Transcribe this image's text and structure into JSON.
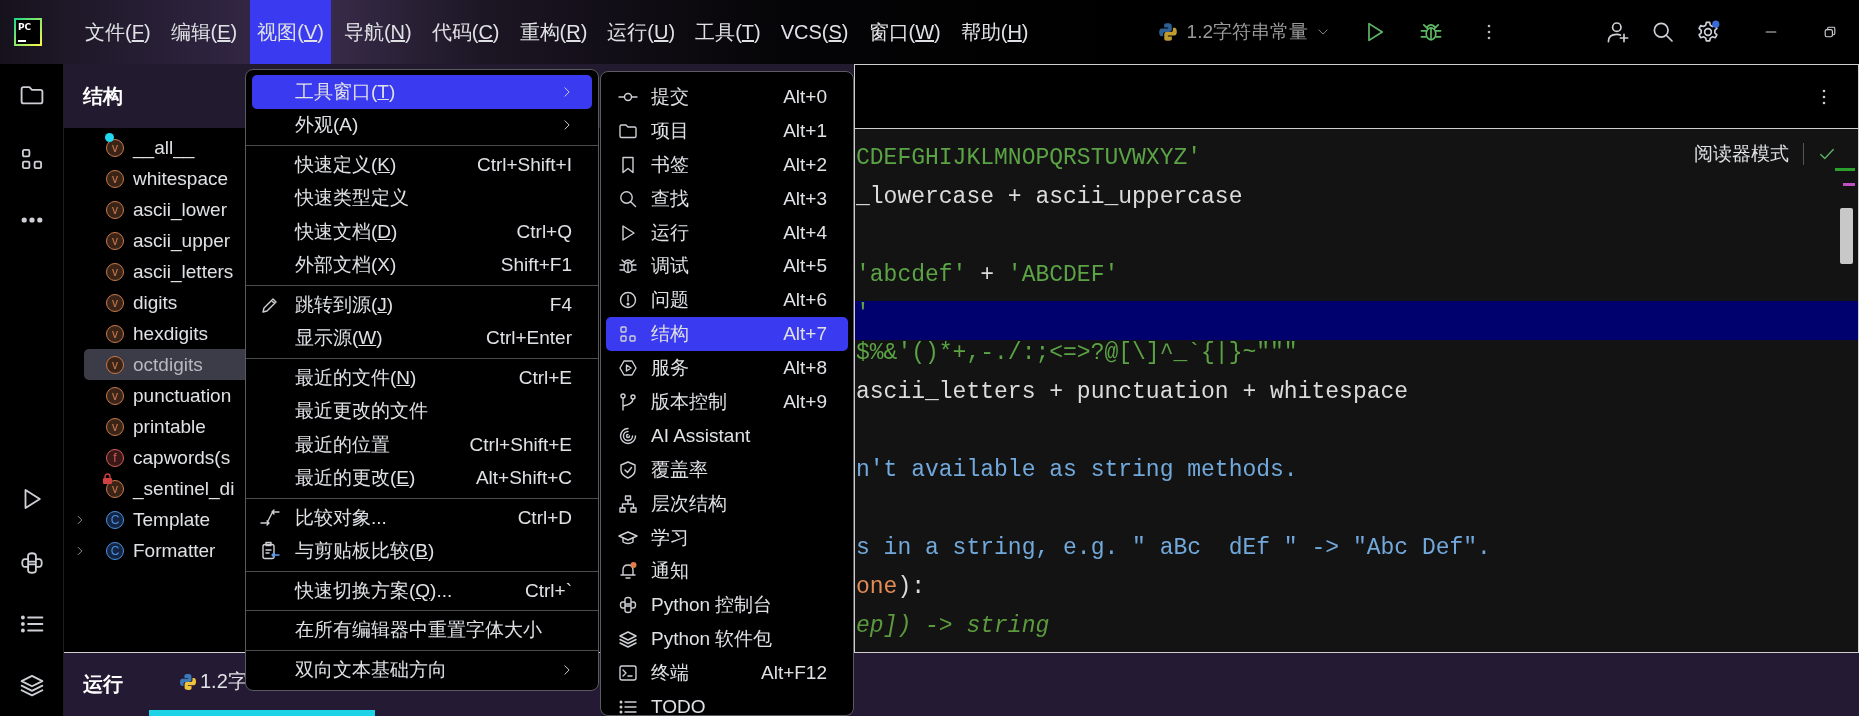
{
  "app_logo": "PC",
  "menubar": {
    "items": [
      {
        "text": [
          "文件(",
          "F",
          ")"
        ],
        "selected": false
      },
      {
        "text": [
          "编辑(",
          "E",
          ")"
        ],
        "selected": false
      },
      {
        "text": [
          "视图(",
          "V",
          ")"
        ],
        "selected": true
      },
      {
        "text": [
          "导航(",
          "N",
          ")"
        ],
        "selected": false
      },
      {
        "text": [
          "代码(",
          "C",
          ")"
        ],
        "selected": false
      },
      {
        "text": [
          "重构(",
          "R",
          ")"
        ],
        "selected": false
      },
      {
        "text": [
          "运行(",
          "U",
          ")"
        ],
        "selected": false
      },
      {
        "text": [
          "工具(",
          "T",
          ")"
        ],
        "selected": false
      },
      {
        "text": [
          "VCS(",
          "S",
          ")"
        ],
        "selected": false
      },
      {
        "text": [
          "窗口(",
          "W",
          ")"
        ],
        "selected": false
      },
      {
        "text": [
          "帮助(",
          "H",
          ")"
        ],
        "selected": false
      }
    ]
  },
  "run_config": {
    "label": "1.2字符串常量"
  },
  "structure_panel": {
    "title": "结构",
    "items": [
      {
        "kind": "variable",
        "icon_letter": "v",
        "label": "__all__",
        "selected": false,
        "flagged": true,
        "locked": false
      },
      {
        "kind": "variable",
        "icon_letter": "v",
        "label": "whitespace",
        "selected": false
      },
      {
        "kind": "variable",
        "icon_letter": "v",
        "label": "ascii_lower",
        "selected": false
      },
      {
        "kind": "variable",
        "icon_letter": "v",
        "label": "ascii_upper",
        "selected": false
      },
      {
        "kind": "variable",
        "icon_letter": "v",
        "label": "ascii_letters",
        "selected": false
      },
      {
        "kind": "variable",
        "icon_letter": "v",
        "label": "digits",
        "selected": false
      },
      {
        "kind": "variable",
        "icon_letter": "v",
        "label": "hexdigits",
        "selected": false
      },
      {
        "kind": "variable",
        "icon_letter": "v",
        "label": "octdigits",
        "selected": true
      },
      {
        "kind": "variable",
        "icon_letter": "v",
        "label": "punctuation",
        "selected": false
      },
      {
        "kind": "variable",
        "icon_letter": "v",
        "label": "printable",
        "selected": false
      },
      {
        "kind": "function",
        "icon_letter": "f",
        "label": "capwords(s",
        "selected": false
      },
      {
        "kind": "variable",
        "icon_letter": "v",
        "label": "_sentinel_di",
        "selected": false,
        "flagged": false,
        "locked": true
      },
      {
        "kind": "class",
        "icon_letter": "C",
        "label": "Template",
        "selected": false,
        "expanded": false
      },
      {
        "kind": "class",
        "icon_letter": "C",
        "label": "Formatter",
        "selected": false,
        "expanded": false
      }
    ]
  },
  "editor": {
    "reader_mode": "阅读器模式",
    "lines": [
      {
        "highlighted": false,
        "tokens": [
          {
            "kind": "string",
            "text": "CDEFGHIJKLMNOPQRSTUVWXYZ'"
          }
        ]
      },
      {
        "highlighted": false,
        "tokens": [
          {
            "kind": "plain",
            "text": "_lowercase + ascii_uppercase"
          }
        ]
      },
      {
        "highlighted": false
      },
      {
        "highlighted": false,
        "tokens": [
          {
            "kind": "string",
            "text": "'abcdef'"
          },
          {
            "kind": "plain",
            "text": " + "
          },
          {
            "kind": "string",
            "text": "'ABCDEF'"
          }
        ]
      },
      {
        "highlighted": true,
        "tokens": [
          {
            "kind": "string",
            "text": "'"
          }
        ]
      },
      {
        "highlighted": false,
        "tokens": [
          {
            "kind": "string",
            "text": "$%&'()*+,-./:;<=>?@[\\]^_`{|}~\"\"\""
          }
        ]
      },
      {
        "highlighted": false,
        "tokens": [
          {
            "kind": "plain",
            "text": "ascii_letters + punctuation + whitespace"
          }
        ]
      },
      {
        "highlighted": false
      },
      {
        "highlighted": false,
        "tokens": [
          {
            "kind": "doc",
            "text": "n't available as string methods."
          }
        ]
      },
      {
        "highlighted": false
      },
      {
        "highlighted": false,
        "tokens": [
          {
            "kind": "doc",
            "text": "s in a string, e.g. \" aBc  dEf \" -> \"Abc Def\"."
          }
        ]
      },
      {
        "highlighted": false,
        "tokens": [
          {
            "kind": "param",
            "text": "one"
          },
          {
            "kind": "plain",
            "text": "):"
          }
        ]
      },
      {
        "highlighted": false,
        "tokens": [
          {
            "kind": "comment",
            "text": "ep]) -> string"
          }
        ]
      }
    ]
  },
  "run_panel": {
    "title": "运行",
    "tab": {
      "label": "1.2字",
      "selected": true
    }
  },
  "view_menu": {
    "items": [
      {
        "kind": "item",
        "text": [
          "工具窗口(",
          "T",
          ")"
        ],
        "submenu": true,
        "selected": true
      },
      {
        "kind": "item",
        "text": [
          "外观(A)"
        ],
        "submenu": true,
        "selected": false
      },
      {
        "kind": "separator"
      },
      {
        "kind": "item",
        "text": [
          "快速定义(",
          "K",
          ")"
        ],
        "shortcut": "Ctrl+Shift+I",
        "submenu": false,
        "selected": false
      },
      {
        "kind": "item",
        "text": [
          "快速类型定义"
        ],
        "submenu": false,
        "selected": false
      },
      {
        "kind": "item",
        "text": [
          "快速文档(",
          "D",
          ")"
        ],
        "shortcut": "Ctrl+Q",
        "submenu": false,
        "selected": false
      },
      {
        "kind": "item",
        "text": [
          "外部文档(X)"
        ],
        "shortcut": "Shift+F1",
        "submenu": false,
        "selected": false
      },
      {
        "kind": "separator"
      },
      {
        "kind": "item",
        "text": [
          "跳转到源(",
          "J",
          ")"
        ],
        "shortcut": "F4",
        "submenu": false,
        "selected": false
      },
      {
        "kind": "item",
        "text": [
          "显示源(",
          "W",
          ")"
        ],
        "shortcut": "Ctrl+Enter",
        "submenu": false,
        "selected": false
      },
      {
        "kind": "separator"
      },
      {
        "kind": "item",
        "text": [
          "最近的文件(",
          "N",
          ")"
        ],
        "shortcut": "Ctrl+E",
        "submenu": false,
        "selected": false
      },
      {
        "kind": "item",
        "text": [
          "最近更改的文件"
        ],
        "submenu": false,
        "selected": false
      },
      {
        "kind": "item",
        "text": [
          "最近的位置"
        ],
        "shortcut": "Ctrl+Shift+E",
        "submenu": false,
        "selected": false
      },
      {
        "kind": "item",
        "text": [
          "最近的更改(",
          "E",
          ")"
        ],
        "shortcut": "Alt+Shift+C",
        "submenu": false,
        "selected": false
      },
      {
        "kind": "separator"
      },
      {
        "kind": "item",
        "text": [
          "比较对象..."
        ],
        "shortcut": "Ctrl+D",
        "submenu": false,
        "selected": false
      },
      {
        "kind": "item",
        "text": [
          "与剪贴板比较(",
          "B",
          ")"
        ],
        "submenu": false,
        "selected": false
      },
      {
        "kind": "separator"
      },
      {
        "kind": "item",
        "text": [
          "快速切换方案(",
          "Q",
          ")..."
        ],
        "shortcut": "Ctrl+`",
        "submenu": false,
        "selected": false
      },
      {
        "kind": "separator"
      },
      {
        "kind": "item",
        "text": [
          "在所有编辑器中重置字体大小"
        ],
        "submenu": false,
        "selected": false
      },
      {
        "kind": "separator"
      },
      {
        "kind": "item",
        "text": [
          "双向文本基础方向"
        ],
        "submenu": true,
        "selected": false
      }
    ]
  },
  "tool_windows_menu": {
    "items": [
      {
        "label": "提交",
        "shortcut": "Alt+0",
        "selected": false
      },
      {
        "label": "项目",
        "shortcut": "Alt+1",
        "selected": false
      },
      {
        "label": "书签",
        "shortcut": "Alt+2",
        "selected": false
      },
      {
        "label": "查找",
        "shortcut": "Alt+3",
        "selected": false
      },
      {
        "label": "运行",
        "shortcut": "Alt+4",
        "selected": false
      },
      {
        "label": "调试",
        "shortcut": "Alt+5",
        "selected": false
      },
      {
        "label": "问题",
        "shortcut": "Alt+6",
        "selected": false
      },
      {
        "label": "结构",
        "shortcut": "Alt+7",
        "selected": true
      },
      {
        "label": "服务",
        "shortcut": "Alt+8",
        "selected": false
      },
      {
        "label": "版本控制",
        "shortcut": "Alt+9",
        "selected": false
      },
      {
        "label": "AI Assistant",
        "selected": false
      },
      {
        "label": "覆盖率",
        "selected": false
      },
      {
        "label": "层次结构",
        "selected": false
      },
      {
        "label": "学习",
        "selected": false
      },
      {
        "label": "通知",
        "selected": false
      },
      {
        "label": "Python 控制台",
        "selected": false
      },
      {
        "label": "Python 软件包",
        "selected": false
      },
      {
        "label": "终端",
        "shortcut": "Alt+F12",
        "selected": false
      },
      {
        "label": "TODO",
        "selected": false
      }
    ]
  }
}
